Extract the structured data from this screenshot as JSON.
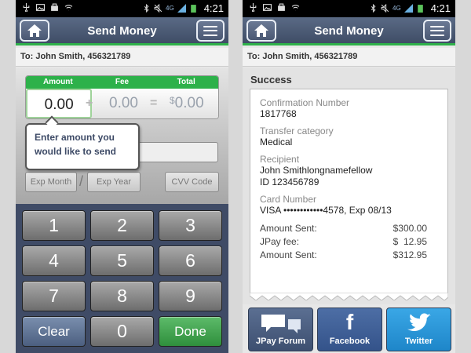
{
  "status_bar": {
    "time": "4:21",
    "network": "4G"
  },
  "left_screen": {
    "header": {
      "title": "Send Money"
    },
    "recipient_line": "To: John Smith, 456321789",
    "amount_table": {
      "headers": {
        "amount": "Amount",
        "fee": "Fee",
        "total": "Total"
      },
      "amount": "0.00",
      "fee": "0.00",
      "total_currency": "$",
      "total": "0.00",
      "plus_symbol": "+",
      "equals_symbol": "="
    },
    "tooltip": "Enter amount you would like to send",
    "fields": {
      "exp_month": "Exp Month",
      "exp_year": "Exp Year",
      "cvv": "CVV Code",
      "separator": "/"
    },
    "keypad": {
      "keys": [
        "1",
        "2",
        "3",
        "4",
        "5",
        "6",
        "7",
        "8",
        "9"
      ],
      "clear": "Clear",
      "zero": "0",
      "done": "Done"
    }
  },
  "right_screen": {
    "header": {
      "title": "Send Money"
    },
    "recipient_line": "To: John Smith, 456321789",
    "success_title": "Success",
    "receipt": {
      "confirmation_label": "Confirmation Number",
      "confirmation_value": "1817768",
      "category_label": "Transfer category",
      "category_value": "Medical",
      "recipient_label": "Recipient",
      "recipient_name": "John Smithlongnamefellow",
      "recipient_id": "ID 123456789",
      "card_label": "Card Number",
      "card_value": "VISA ••••••••••••4578, Exp 08/13",
      "amount_sent_label": "Amount Sent:",
      "amount_sent_value": "$300.00",
      "fee_label": "JPay fee:",
      "fee_value": "$  12.95",
      "total_label": "Amount Sent:",
      "total_value": "$312.95"
    },
    "social": {
      "forum": "JPay Forum",
      "facebook": "Facebook",
      "twitter": "Twitter"
    }
  },
  "colors": {
    "header": "#4a5873",
    "accent_green": "#2fb14a",
    "keypad_bg": "#3f4b66"
  }
}
